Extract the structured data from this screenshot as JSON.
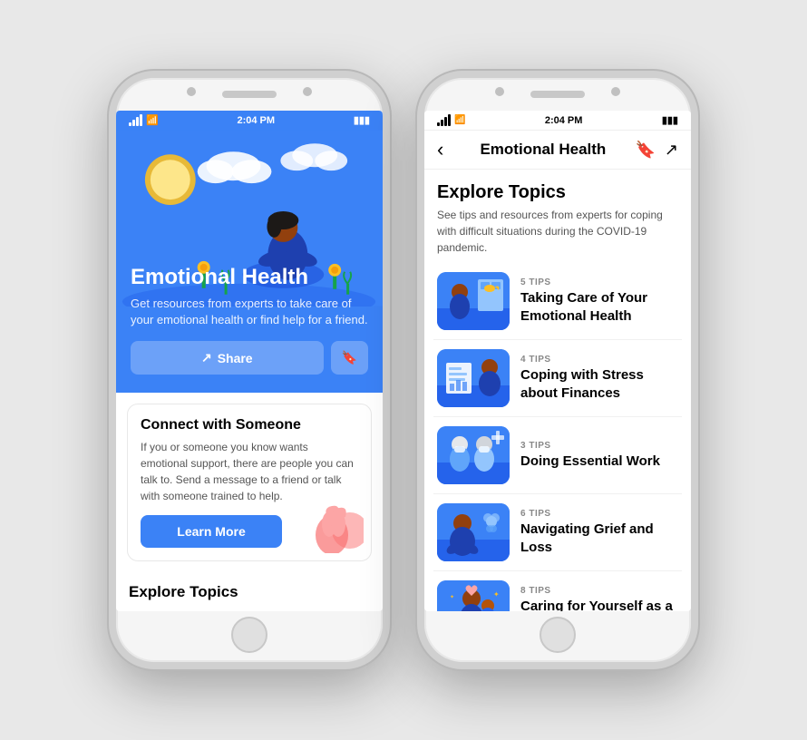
{
  "phone1": {
    "status_bar": {
      "signal": "●●●",
      "wifi": "wifi",
      "time": "2:04 PM",
      "battery": "battery"
    },
    "hero": {
      "back_label": "‹",
      "title": "Emotional Health",
      "subtitle": "Get resources from experts to take care of your emotional health or find help for a friend.",
      "share_label": "Share",
      "save_label": "🔖"
    },
    "connect_card": {
      "title": "Connect with Someone",
      "description": "If you or someone you know wants emotional support, there are people you can talk to. Send a message to a friend or talk with someone trained to help.",
      "cta_label": "Learn More"
    },
    "explore": {
      "title": "Explore Topics"
    }
  },
  "phone2": {
    "status_bar": {
      "signal": "●●●",
      "wifi": "wifi",
      "time": "2:04 PM",
      "battery": "battery"
    },
    "header": {
      "back_label": "‹",
      "title": "Emotional Health",
      "bookmark_icon": "bookmark",
      "share_icon": "share"
    },
    "explore": {
      "title": "Explore Topics",
      "description": "See tips and resources from experts for coping with difficult situations during the COVID-19 pandemic."
    },
    "topics": [
      {
        "count_label": "5 TIPS",
        "name": "Taking Care of Your Emotional Health",
        "thumb_color": "#3b82f6"
      },
      {
        "count_label": "4 TIPS",
        "name": "Coping with Stress about Finances",
        "thumb_color": "#3b82f6"
      },
      {
        "count_label": "3 TIPS",
        "name": "Doing Essential Work",
        "thumb_color": "#3b82f6"
      },
      {
        "count_label": "6 TIPS",
        "name": "Navigating Grief and Loss",
        "thumb_color": "#3b82f6"
      },
      {
        "count_label": "8 TIPS",
        "name": "Caring for Yourself as a Parent",
        "thumb_color": "#3b82f6"
      }
    ]
  }
}
